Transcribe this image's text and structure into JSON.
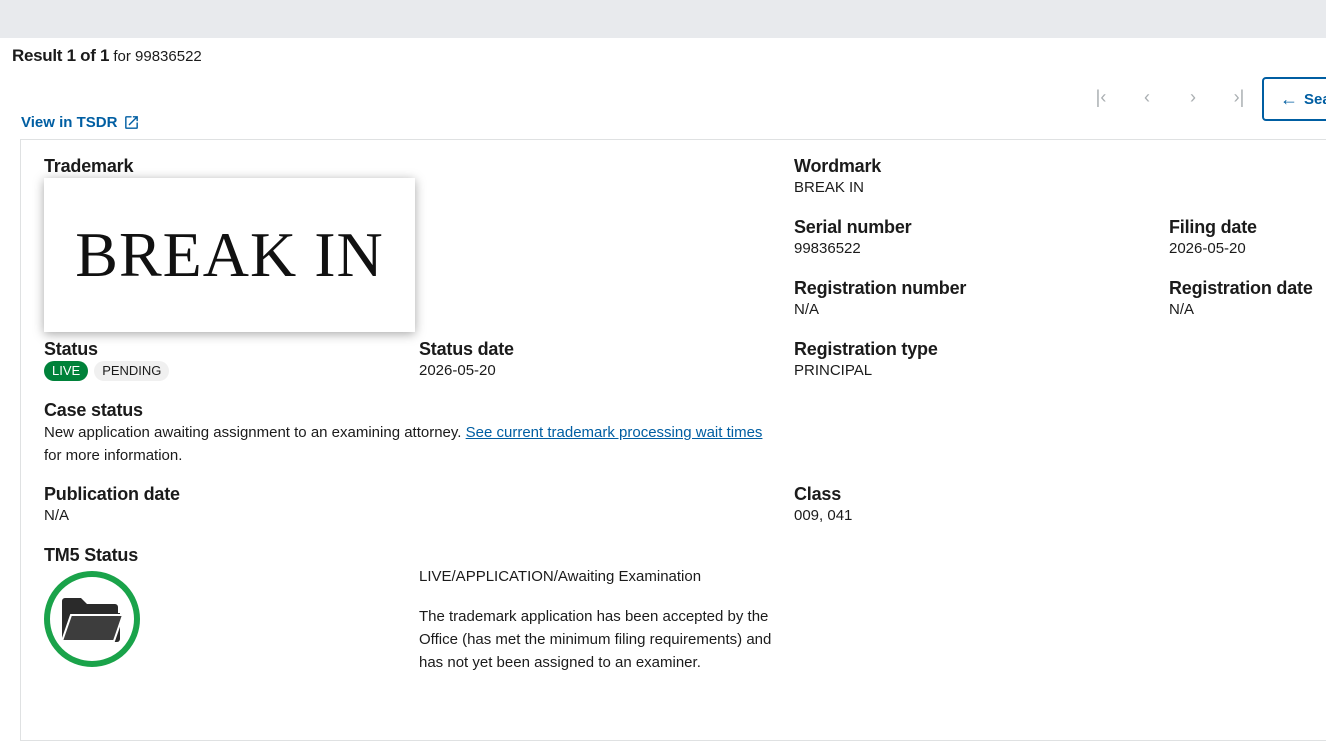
{
  "result": {
    "prefix": "Result 1 of 1",
    "suffix": "for 99836522"
  },
  "pager": {
    "first": "|‹",
    "prev": "‹",
    "next": "›",
    "last": "›|"
  },
  "search_button": {
    "label": "Sea"
  },
  "tsdr_link": {
    "label": "View in TSDR"
  },
  "trademark": {
    "label": "Trademark",
    "image_text": "BREAK IN"
  },
  "wordmark": {
    "label": "Wordmark",
    "value": "BREAK IN"
  },
  "serial": {
    "label": "Serial number",
    "value": "99836522"
  },
  "filing": {
    "label": "Filing date",
    "value": "2026-05-20"
  },
  "registration_number": {
    "label": "Registration number",
    "value": "N/A"
  },
  "registration_date": {
    "label": "Registration date",
    "value": "N/A"
  },
  "status": {
    "label": "Status",
    "tags": [
      "LIVE",
      "PENDING"
    ]
  },
  "status_date": {
    "label": "Status date",
    "value": "2026-05-20"
  },
  "registration_type": {
    "label": "Registration type",
    "value": "PRINCIPAL"
  },
  "case_status": {
    "label": "Case status",
    "text": "New application awaiting assignment to an examining attorney.",
    "link": "See current trademark processing wait times ",
    "after": "for more information."
  },
  "publication_date": {
    "label": "Publication date",
    "value": "N/A"
  },
  "class": {
    "label": "Class",
    "value": "009, 041"
  },
  "tm5": {
    "label": "TM5 Status",
    "headline": "LIVE/APPLICATION/Awaiting Examination",
    "description": "The trademark application has been accepted by the Office (has met the minimum filing requirements) and has not yet been assigned to an examiner.",
    "icon": "folder-icon",
    "ring_color": "#1aa34a"
  },
  "colors": {
    "link": "#005ea2",
    "live": "#00823a"
  }
}
